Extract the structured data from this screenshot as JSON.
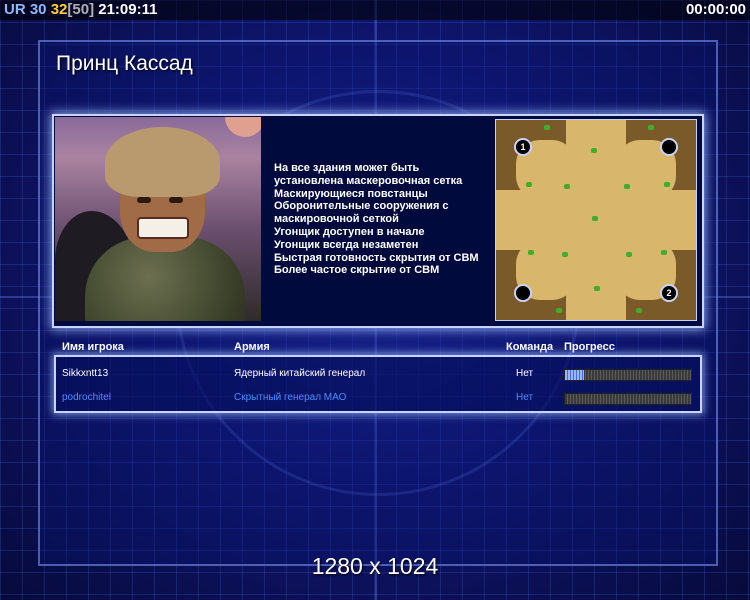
{
  "hud": {
    "ur_label": "UR",
    "num_30": "30",
    "num_32": "32",
    "bracket_50": "[50]",
    "clock": "21:09:11",
    "timer": "00:00:00"
  },
  "title": "Принц Кассад",
  "description": [
    "На все здания может быть",
    " установлена маскеровочная сетка",
    "Маскирующиеся повстанцы",
    "Оборонительные сооружения с",
    " маскировочной сеткой",
    "Угонщик доступен в начале",
    "Угонщик всегда незаметен",
    "Быстрая готовность скрытия от СВМ",
    "Более частое скрытие от СВМ"
  ],
  "minimap": {
    "start_positions": [
      "1",
      "",
      "",
      "2"
    ]
  },
  "table": {
    "headers": {
      "name": "Имя игрока",
      "army": "Армия",
      "team": "Команда",
      "progress": "Прогресс"
    },
    "rows": [
      {
        "name": "Sikkxntt13",
        "army": "Ядерный китайский генерал",
        "team": "Нет",
        "progress": 0.15,
        "color": "#ffffff"
      },
      {
        "name": "podrochitel",
        "army": "Скрытный генерал МАО",
        "team": "Нет",
        "progress": 0.0,
        "color": "#4f8cff"
      }
    ]
  },
  "resolution": "1280 x 1024"
}
